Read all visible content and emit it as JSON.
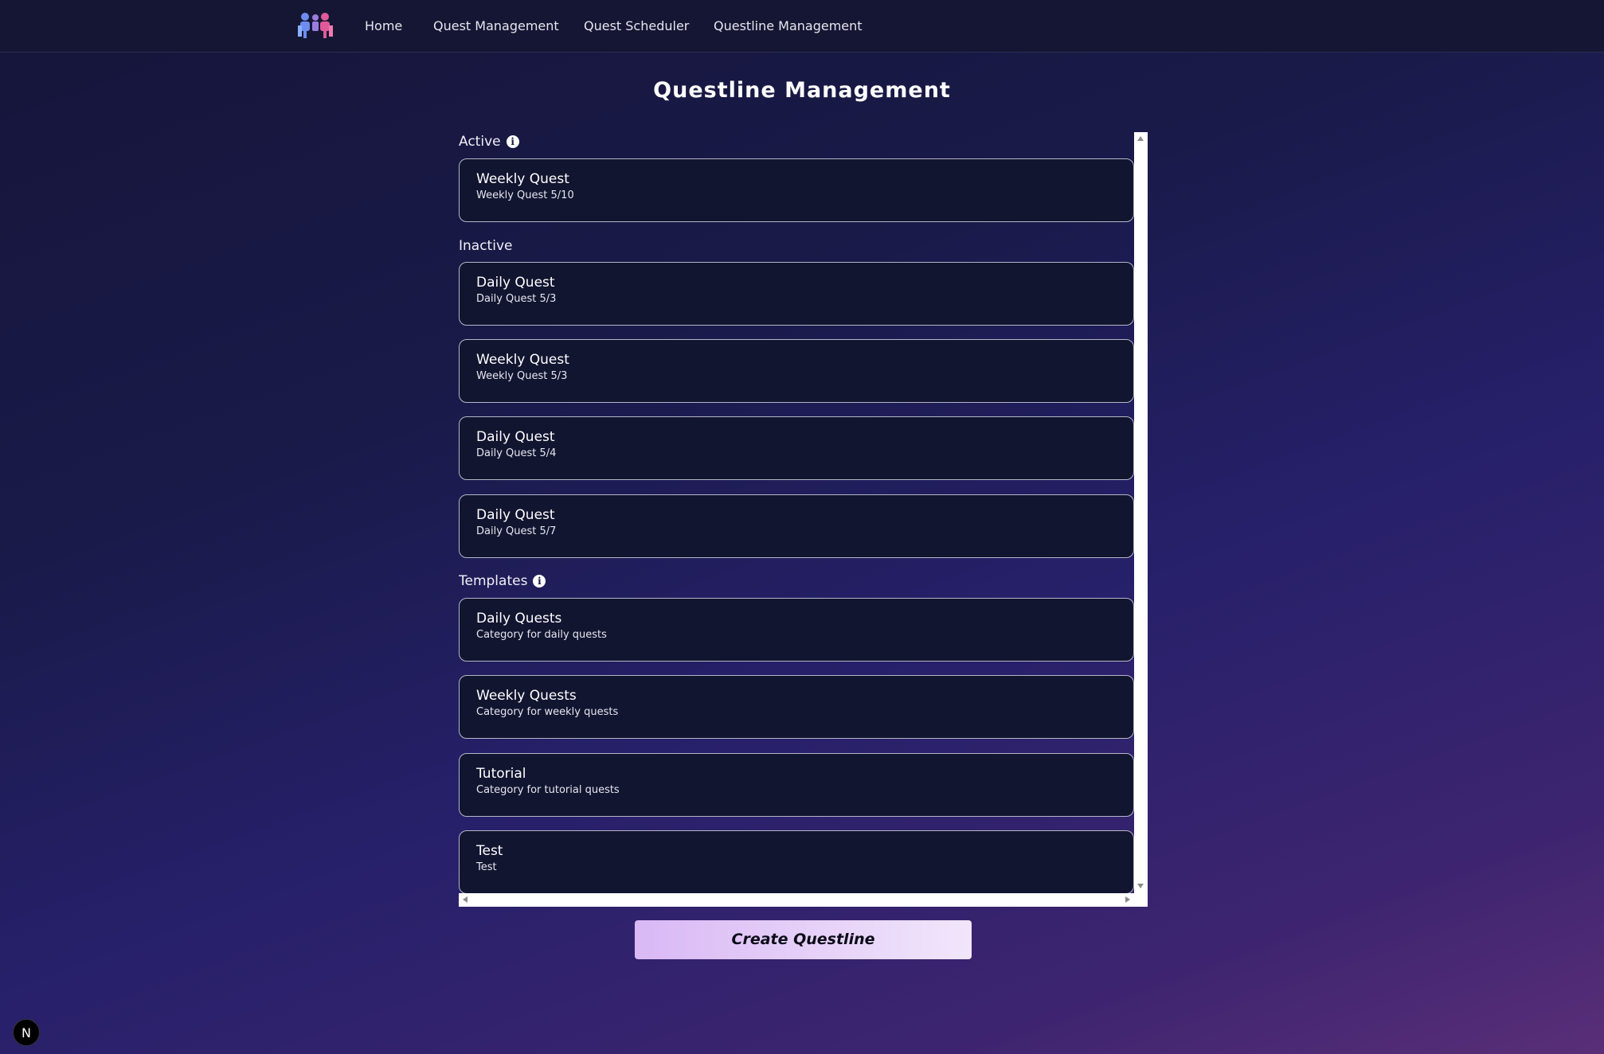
{
  "nav": {
    "links": [
      "Home",
      "Quest Management",
      "Quest Scheduler",
      "Questline Management"
    ]
  },
  "page": {
    "title": "Questline Management"
  },
  "sections": {
    "active": {
      "label": "Active",
      "items": [
        {
          "title": "Weekly Quest",
          "subtitle": "Weekly Quest 5/10"
        }
      ]
    },
    "inactive": {
      "label": "Inactive",
      "items": [
        {
          "title": "Daily Quest",
          "subtitle": "Daily Quest 5/3"
        },
        {
          "title": "Weekly Quest",
          "subtitle": "Weekly Quest 5/3"
        },
        {
          "title": "Daily Quest",
          "subtitle": "Daily Quest 5/4"
        },
        {
          "title": "Daily Quest",
          "subtitle": "Daily Quest 5/7"
        }
      ]
    },
    "templates": {
      "label": "Templates",
      "items": [
        {
          "title": "Daily Quests",
          "subtitle": "Category for daily quests"
        },
        {
          "title": "Weekly Quests",
          "subtitle": "Category for weekly quests"
        },
        {
          "title": "Tutorial",
          "subtitle": "Category for tutorial quests"
        },
        {
          "title": "Test",
          "subtitle": "Test"
        }
      ]
    }
  },
  "actions": {
    "create_label": "Create Questline"
  },
  "badge": {
    "label": "N"
  },
  "icons": {
    "info": "info-icon",
    "logo": "people-logo-icon"
  },
  "colors": {
    "logo_blue": "#6c8cf0",
    "logo_pink": "#e05a9a",
    "button_gradient_start": "#d9b8f5",
    "button_gradient_end": "#f1e6fb"
  }
}
